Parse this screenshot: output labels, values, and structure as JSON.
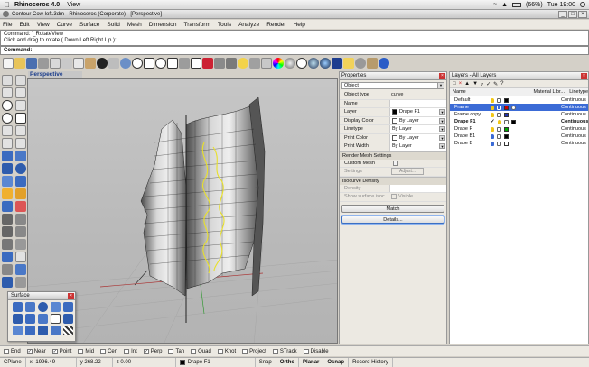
{
  "macbar": {
    "app": "Rhinoceros 4.0",
    "menu": [
      "View"
    ],
    "battery": "(66%)",
    "clock": "Tue 19:00"
  },
  "window": {
    "title": "Contour Cow loft.3dm - Rhinoceros (Corporate) - [Perspective]"
  },
  "menu": [
    "File",
    "Edit",
    "View",
    "Curve",
    "Surface",
    "Solid",
    "Mesh",
    "Dimension",
    "Transform",
    "Tools",
    "Analyze",
    "Render",
    "Help"
  ],
  "command": {
    "history1": "Command: '_RotateView",
    "history2": "Click and drag to rotate ( Down  Left  Right  Up ):",
    "label": "Command:",
    "value": ""
  },
  "viewport": {
    "name": "Perspective"
  },
  "properties": {
    "title": "Properties",
    "selector": "Object",
    "rows": [
      {
        "key": "Object type",
        "value": "curve"
      },
      {
        "key": "Name",
        "value": ""
      },
      {
        "key": "Layer",
        "value": "Drape F1",
        "color": "#000000"
      },
      {
        "key": "Display Color",
        "value": "By Layer",
        "color": "#ffffff"
      },
      {
        "key": "Linetype",
        "value": "By Layer"
      },
      {
        "key": "Print Color",
        "value": "By Layer",
        "color": "#ffffff"
      },
      {
        "key": "Print Width",
        "value": "By Layer"
      }
    ],
    "render_mesh": {
      "title": "Render Mesh Settings",
      "custom": "Custom Mesh",
      "settings": "Settings",
      "adjust": "Adjust..."
    },
    "isocurve": {
      "title": "Isocurve Density",
      "density": "Density",
      "show": "Show surface isoc",
      "visible": "Visible"
    },
    "match": "Match",
    "details": "Details..."
  },
  "layers": {
    "title": "Layers - All Layers",
    "columns": {
      "name": "Name",
      "material": "Material Libr...",
      "linetype": "Linetype"
    },
    "rows": [
      {
        "name": "Default",
        "color": "#000000",
        "linetype": "Continuous",
        "selected": false,
        "bold": false
      },
      {
        "name": "Frame",
        "color": "#cc0000",
        "linetype": "Continuous",
        "selected": true,
        "bold": false
      },
      {
        "name": "Frame copy",
        "color": "#2233aa",
        "linetype": "Continuous",
        "selected": false,
        "bold": false
      },
      {
        "name": "Drape F1",
        "color": "#000000",
        "linetype": "Continuous",
        "selected": false,
        "bold": true
      },
      {
        "name": "Drape F",
        "color": "#00aa00",
        "linetype": "Continuous",
        "selected": false,
        "bold": false
      },
      {
        "name": "Drape B1",
        "color": "#000000",
        "linetype": "Continuous",
        "selected": false,
        "bold": false
      },
      {
        "name": "Drape B",
        "color": "#ffffff",
        "linetype": "Continuous",
        "selected": false,
        "bold": false
      }
    ]
  },
  "surface_palette": {
    "title": "Surface"
  },
  "osnap": [
    {
      "label": "End",
      "checked": false
    },
    {
      "label": "Near",
      "checked": true
    },
    {
      "label": "Point",
      "checked": true
    },
    {
      "label": "Mid",
      "checked": false
    },
    {
      "label": "Cen",
      "checked": false
    },
    {
      "label": "Int",
      "checked": false
    },
    {
      "label": "Perp",
      "checked": true
    },
    {
      "label": "Tan",
      "checked": false
    },
    {
      "label": "Quad",
      "checked": false
    },
    {
      "label": "Knot",
      "checked": false
    },
    {
      "label": "Project",
      "checked": false
    },
    {
      "label": "STrack",
      "checked": false
    },
    {
      "label": "Disable",
      "checked": false
    }
  ],
  "status": {
    "cplane": "CPlane",
    "x": "x -1996.49",
    "y": "y 268.22",
    "z": "z 0.00",
    "layer": "Drape F1",
    "snap": "Snap",
    "ortho": "Ortho",
    "planar": "Planar",
    "osnap": "Osnap",
    "history": "Record History"
  }
}
